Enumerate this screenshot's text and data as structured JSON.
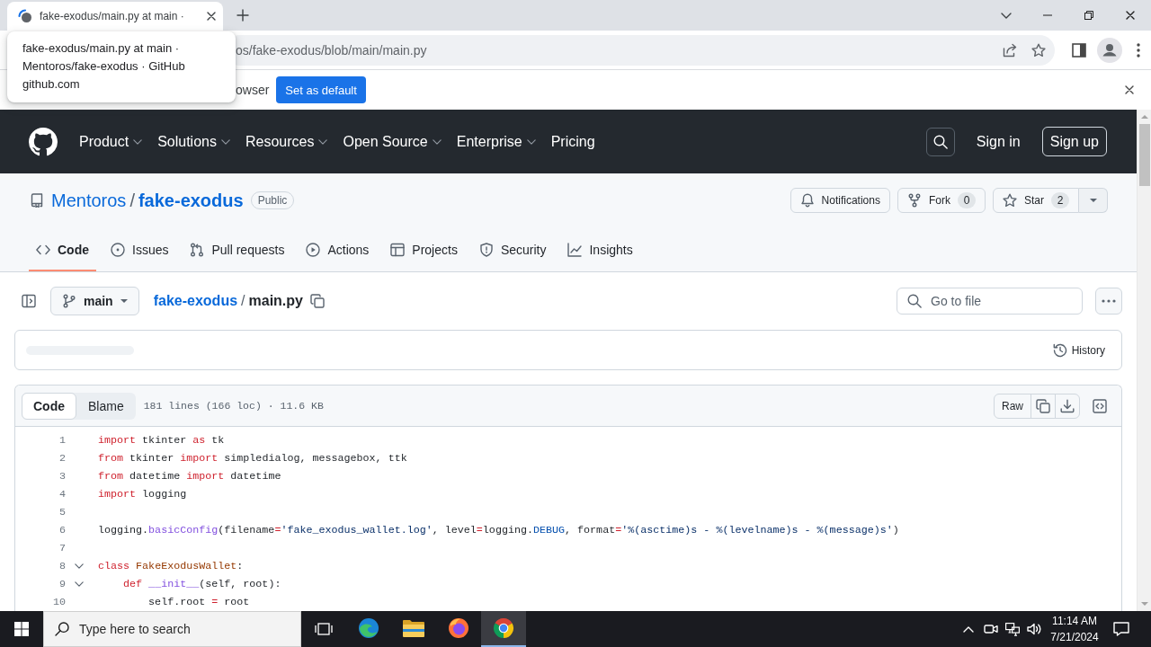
{
  "browser": {
    "tabs": [
      {
        "title": "fake-exodus/main.py at main ·",
        "selected": true
      }
    ],
    "tooltip": {
      "title": "fake-exodus/main.py at main · Mentoros/fake-exodus · GitHub",
      "url": "github.com"
    },
    "address_bar": {
      "value": "os/fake-exodus/blob/main/main.py"
    },
    "infobar": {
      "message": "owser",
      "button": "Set as default"
    }
  },
  "site_header": {
    "nav": [
      {
        "label": "Product",
        "menu": true
      },
      {
        "label": "Solutions",
        "menu": true
      },
      {
        "label": "Resources",
        "menu": true
      },
      {
        "label": "Open Source",
        "menu": true
      },
      {
        "label": "Enterprise",
        "menu": true
      },
      {
        "label": "Pricing",
        "menu": false
      }
    ],
    "sign_in": "Sign in",
    "sign_up": "Sign up"
  },
  "repo": {
    "owner": "Mentoros",
    "separator": "/",
    "name": "fake-exodus",
    "visibility": "Public",
    "actions": [
      {
        "kind": "notifications",
        "label": "Notifications"
      },
      {
        "kind": "fork",
        "label": "Fork",
        "count": "0"
      },
      {
        "kind": "star",
        "label": "Star",
        "count": "2"
      }
    ],
    "tabs": [
      {
        "kind": "code",
        "label": "Code",
        "selected": true
      },
      {
        "kind": "issues",
        "label": "Issues",
        "selected": false
      },
      {
        "kind": "pulls",
        "label": "Pull requests",
        "selected": false
      },
      {
        "kind": "actions",
        "label": "Actions",
        "selected": false
      },
      {
        "kind": "projects",
        "label": "Projects",
        "selected": false
      },
      {
        "kind": "security",
        "label": "Security",
        "selected": false
      },
      {
        "kind": "insights",
        "label": "Insights",
        "selected": false
      }
    ]
  },
  "file_nav": {
    "branch": "main",
    "path": [
      {
        "kind": "link",
        "label": "fake-exodus"
      },
      {
        "kind": "current",
        "label": "main.py"
      }
    ],
    "separator": "/",
    "search": {
      "placeholder": "Go to file"
    }
  },
  "commit_bar": {
    "history": "History"
  },
  "file": {
    "views": [
      {
        "label": "Code",
        "selected": true
      },
      {
        "label": "Blame",
        "selected": false
      }
    ],
    "info": "181 lines (166 loc) · 11.6 KB",
    "raw": "Raw",
    "lines": [
      {
        "number": "1",
        "tokens": [
          {
            "kind": "keyword",
            "text": "import"
          },
          {
            "kind": "plain",
            "text": " tkinter "
          },
          {
            "kind": "keyword",
            "text": "as"
          },
          {
            "kind": "plain",
            "text": " tk"
          }
        ]
      },
      {
        "number": "2",
        "tokens": [
          {
            "kind": "keyword",
            "text": "from"
          },
          {
            "kind": "plain",
            "text": " tkinter "
          },
          {
            "kind": "keyword",
            "text": "import"
          },
          {
            "kind": "plain",
            "text": " simpledialog, messagebox, ttk"
          }
        ]
      },
      {
        "number": "3",
        "tokens": [
          {
            "kind": "keyword",
            "text": "from"
          },
          {
            "kind": "plain",
            "text": " datetime "
          },
          {
            "kind": "keyword",
            "text": "import"
          },
          {
            "kind": "plain",
            "text": " datetime"
          }
        ]
      },
      {
        "number": "4",
        "tokens": [
          {
            "kind": "keyword",
            "text": "import"
          },
          {
            "kind": "plain",
            "text": " logging"
          }
        ]
      },
      {
        "number": "5"
      },
      {
        "number": "6",
        "tokens": [
          {
            "kind": "plain",
            "text": "logging."
          },
          {
            "kind": "function",
            "text": "basicConfig"
          },
          {
            "kind": "plain",
            "text": "(filename"
          },
          {
            "kind": "keyword",
            "text": "="
          },
          {
            "kind": "string",
            "text": "'fake_exodus_wallet.log'"
          },
          {
            "kind": "plain",
            "text": ", level"
          },
          {
            "kind": "keyword",
            "text": "="
          },
          {
            "kind": "plain",
            "text": "logging."
          },
          {
            "kind": "constant",
            "text": "DEBUG"
          },
          {
            "kind": "plain",
            "text": ", format"
          },
          {
            "kind": "keyword",
            "text": "="
          },
          {
            "kind": "string",
            "text": "'%(asctime)s - %(levelname)s - %(message)s'"
          },
          {
            "kind": "plain",
            "text": ")"
          }
        ]
      },
      {
        "number": "7"
      },
      {
        "number": "8",
        "toggle": {
          "expanded": true
        },
        "tokens": [
          {
            "kind": "keyword",
            "text": "class"
          },
          {
            "kind": "class",
            "text": " FakeExodusWallet"
          },
          {
            "kind": "plain",
            "text": ":"
          }
        ]
      },
      {
        "number": "9",
        "toggle": {
          "expanded": true
        },
        "tokens": [
          {
            "kind": "keyword",
            "text": "    def"
          },
          {
            "kind": "function",
            "text": " __init__"
          },
          {
            "kind": "plain",
            "text": "(self, root):"
          }
        ]
      },
      {
        "number": "10",
        "tokens": [
          {
            "kind": "plain",
            "text": "        self.root "
          },
          {
            "kind": "keyword",
            "text": "="
          },
          {
            "kind": "plain",
            "text": " root"
          }
        ]
      }
    ]
  },
  "taskbar": {
    "search": {
      "placeholder": "Type here to search"
    },
    "apps": [
      {
        "kind": "edge",
        "selected": false
      },
      {
        "kind": "explorer",
        "selected": false
      },
      {
        "kind": "firefox",
        "selected": false
      },
      {
        "kind": "chrome",
        "selected": true
      }
    ],
    "time": "11:14 AM",
    "date": "7/21/2024"
  }
}
